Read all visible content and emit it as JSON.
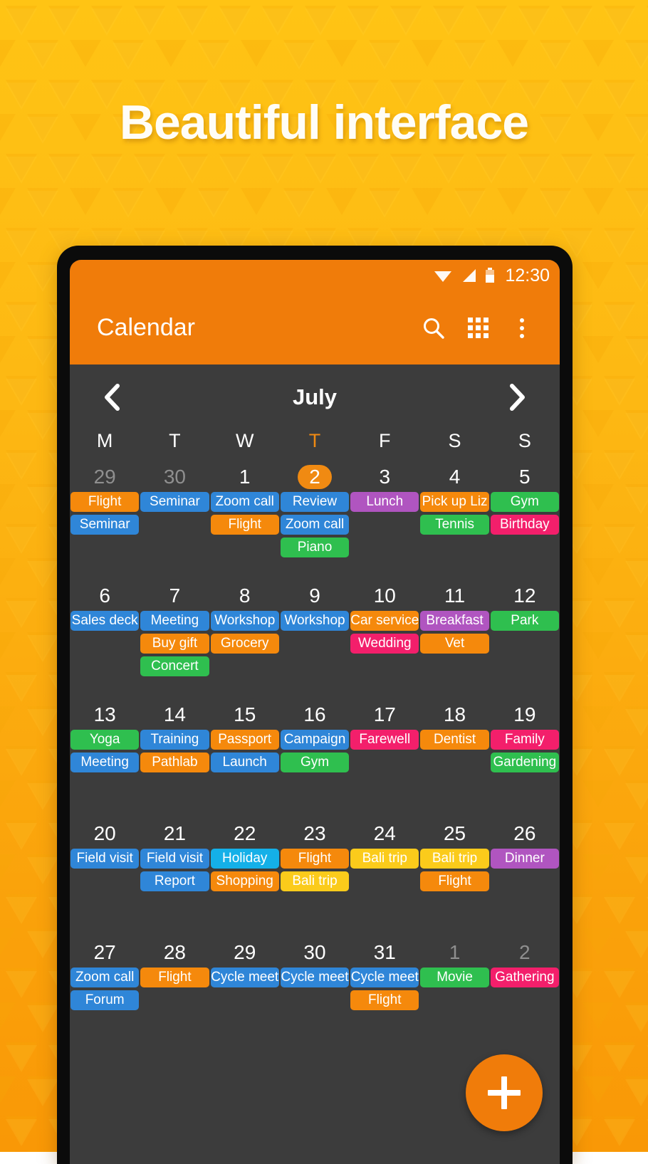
{
  "promo": {
    "headline": "Beautiful interface",
    "background_top_color": "#FFC414",
    "background_bottom_color": "#F99806"
  },
  "status_bar": {
    "time": "12:30",
    "icons": [
      "wifi-icon",
      "signal-icon",
      "battery-icon"
    ]
  },
  "app_bar": {
    "title": "Calendar",
    "accent_color": "#F07C0A",
    "actions": [
      {
        "name": "search-icon",
        "label": "Search"
      },
      {
        "name": "grid-view-icon",
        "label": "Grid view"
      },
      {
        "name": "overflow-menu-icon",
        "label": "More options"
      }
    ]
  },
  "month_bar": {
    "prev_label": "‹",
    "month": "July",
    "next_label": "›"
  },
  "weekdays": [
    {
      "label": "M",
      "today": false
    },
    {
      "label": "T",
      "today": false
    },
    {
      "label": "W",
      "today": false
    },
    {
      "label": "T",
      "today": true
    },
    {
      "label": "F",
      "today": false
    },
    {
      "label": "S",
      "today": false
    },
    {
      "label": "S",
      "today": false
    }
  ],
  "event_colors": {
    "blue": "#2F86D8",
    "orange": "#F5890C",
    "green": "#2FBF4F",
    "purple": "#B055C0",
    "pink": "#F31F6B",
    "cyan": "#14B0E8",
    "yellow": "#FBCB1B"
  },
  "weeks": [
    {
      "days": [
        {
          "num": "29",
          "state": "muted",
          "events": [
            {
              "title": "Flight",
              "color": "orange"
            },
            {
              "title": "Seminar",
              "color": "blue"
            }
          ]
        },
        {
          "num": "30",
          "state": "muted",
          "events": [
            {
              "title": "Seminar",
              "color": "blue"
            }
          ]
        },
        {
          "num": "1",
          "state": "normal",
          "events": [
            {
              "title": "Zoom call",
              "color": "blue"
            },
            {
              "title": "Flight",
              "color": "orange"
            }
          ]
        },
        {
          "num": "2",
          "state": "today",
          "events": [
            {
              "title": "Review",
              "color": "blue"
            },
            {
              "title": "Zoom call",
              "color": "blue"
            },
            {
              "title": "Piano",
              "color": "green"
            }
          ]
        },
        {
          "num": "3",
          "state": "normal",
          "events": [
            {
              "title": "Lunch",
              "color": "purple"
            }
          ]
        },
        {
          "num": "4",
          "state": "normal",
          "events": [
            {
              "title": "Pick up Liz",
              "color": "orange"
            },
            {
              "title": "Tennis",
              "color": "green"
            }
          ]
        },
        {
          "num": "5",
          "state": "normal",
          "events": [
            {
              "title": "Gym",
              "color": "green"
            },
            {
              "title": "Birthday",
              "color": "pink"
            }
          ]
        }
      ]
    },
    {
      "days": [
        {
          "num": "6",
          "state": "normal",
          "events": [
            {
              "title": "Sales deck",
              "color": "blue"
            }
          ]
        },
        {
          "num": "7",
          "state": "normal",
          "events": [
            {
              "title": "Meeting",
              "color": "blue"
            },
            {
              "title": "Buy gift",
              "color": "orange"
            },
            {
              "title": "Concert",
              "color": "green"
            }
          ]
        },
        {
          "num": "8",
          "state": "normal",
          "events": [
            {
              "title": "Workshop",
              "color": "blue"
            },
            {
              "title": "Grocery",
              "color": "orange"
            }
          ]
        },
        {
          "num": "9",
          "state": "normal",
          "events": [
            {
              "title": "Workshop",
              "color": "blue"
            }
          ]
        },
        {
          "num": "10",
          "state": "normal",
          "events": [
            {
              "title": "Car service",
              "color": "orange"
            },
            {
              "title": "Wedding",
              "color": "pink"
            }
          ]
        },
        {
          "num": "11",
          "state": "normal",
          "events": [
            {
              "title": "Breakfast",
              "color": "purple"
            },
            {
              "title": "Vet",
              "color": "orange"
            }
          ]
        },
        {
          "num": "12",
          "state": "normal",
          "events": [
            {
              "title": "Park",
              "color": "green"
            }
          ]
        }
      ]
    },
    {
      "days": [
        {
          "num": "13",
          "state": "normal",
          "events": [
            {
              "title": "Yoga",
              "color": "green"
            },
            {
              "title": "Meeting",
              "color": "blue"
            }
          ]
        },
        {
          "num": "14",
          "state": "normal",
          "events": [
            {
              "title": "Training",
              "color": "blue"
            },
            {
              "title": "Pathlab",
              "color": "orange"
            }
          ]
        },
        {
          "num": "15",
          "state": "normal",
          "events": [
            {
              "title": "Passport",
              "color": "orange"
            },
            {
              "title": "Launch",
              "color": "blue"
            }
          ]
        },
        {
          "num": "16",
          "state": "normal",
          "events": [
            {
              "title": "Campaign",
              "color": "blue"
            },
            {
              "title": "Gym",
              "color": "green"
            }
          ]
        },
        {
          "num": "17",
          "state": "normal",
          "events": [
            {
              "title": "Farewell",
              "color": "pink"
            }
          ]
        },
        {
          "num": "18",
          "state": "normal",
          "events": [
            {
              "title": "Dentist",
              "color": "orange"
            }
          ]
        },
        {
          "num": "19",
          "state": "normal",
          "events": [
            {
              "title": "Family",
              "color": "pink"
            },
            {
              "title": "Gardening",
              "color": "green"
            }
          ]
        }
      ]
    },
    {
      "days": [
        {
          "num": "20",
          "state": "normal",
          "events": [
            {
              "title": "Field visit",
              "color": "blue"
            }
          ]
        },
        {
          "num": "21",
          "state": "normal",
          "events": [
            {
              "title": "Field visit",
              "color": "blue"
            },
            {
              "title": "Report",
              "color": "blue"
            }
          ]
        },
        {
          "num": "22",
          "state": "normal",
          "events": [
            {
              "title": "Holiday",
              "color": "cyan"
            },
            {
              "title": "Shopping",
              "color": "orange"
            }
          ]
        },
        {
          "num": "23",
          "state": "normal",
          "events": [
            {
              "title": "Flight",
              "color": "orange"
            },
            {
              "title": "Bali trip",
              "color": "yellow"
            }
          ]
        },
        {
          "num": "24",
          "state": "normal",
          "events": [
            {
              "title": "Bali trip",
              "color": "yellow"
            }
          ]
        },
        {
          "num": "25",
          "state": "normal",
          "events": [
            {
              "title": "Bali trip",
              "color": "yellow"
            },
            {
              "title": "Flight",
              "color": "orange"
            }
          ]
        },
        {
          "num": "26",
          "state": "normal",
          "events": [
            {
              "title": "Dinner",
              "color": "purple"
            }
          ]
        }
      ]
    },
    {
      "days": [
        {
          "num": "27",
          "state": "normal",
          "events": [
            {
              "title": "Zoom call",
              "color": "blue"
            },
            {
              "title": "Forum",
              "color": "blue"
            }
          ]
        },
        {
          "num": "28",
          "state": "normal",
          "events": [
            {
              "title": "Flight",
              "color": "orange"
            }
          ]
        },
        {
          "num": "29",
          "state": "normal",
          "events": [
            {
              "title": "Cycle meet",
              "color": "blue"
            }
          ]
        },
        {
          "num": "30",
          "state": "normal",
          "events": [
            {
              "title": "Cycle meet",
              "color": "blue"
            }
          ]
        },
        {
          "num": "31",
          "state": "normal",
          "events": [
            {
              "title": "Cycle meet",
              "color": "blue"
            },
            {
              "title": "Flight",
              "color": "orange"
            }
          ]
        },
        {
          "num": "1",
          "state": "muted",
          "events": [
            {
              "title": "Movie",
              "color": "green"
            }
          ]
        },
        {
          "num": "2",
          "state": "muted",
          "events": [
            {
              "title": "Gathering",
              "color": "pink"
            }
          ]
        }
      ]
    }
  ],
  "fab": {
    "label": "+",
    "name": "add-event-button",
    "color": "#F07C0A"
  }
}
